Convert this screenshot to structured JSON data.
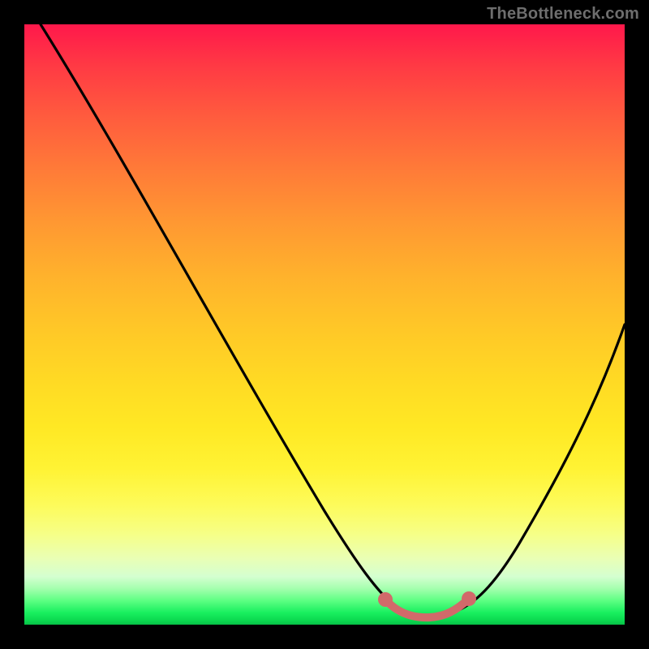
{
  "watermark": "TheBottleneck.com",
  "colors": {
    "frame": "#000000",
    "curve": "#000000",
    "marker": "#d16a6a",
    "gradient_top": "#ff184b",
    "gradient_bottom": "#07c247"
  },
  "chart_data": {
    "type": "line",
    "title": "",
    "xlabel": "",
    "ylabel": "",
    "xlim": [
      0,
      100
    ],
    "ylim": [
      0,
      100
    ],
    "grid": false,
    "legend": false,
    "series": [
      {
        "name": "bottleneck-curve",
        "x": [
          0,
          5,
          10,
          15,
          20,
          25,
          30,
          35,
          40,
          45,
          50,
          55,
          58,
          60,
          62,
          65,
          68,
          70,
          72,
          75,
          80,
          85,
          90,
          95,
          100
        ],
        "y": [
          100,
          93,
          86,
          79,
          72,
          64,
          56,
          48,
          40,
          32,
          24,
          16,
          11,
          8,
          5,
          2,
          1,
          1,
          1,
          2,
          6,
          14,
          24,
          36,
          50
        ]
      }
    ],
    "markers": [
      {
        "name": "optimal-left-end",
        "x": 60,
        "y": 7,
        "r": 1.4
      },
      {
        "name": "optimal-right-end",
        "x": 74,
        "y": 7,
        "r": 1.4
      }
    ],
    "optimal_segment": {
      "x0": 60,
      "x1": 74,
      "y_approx": 6
    }
  }
}
